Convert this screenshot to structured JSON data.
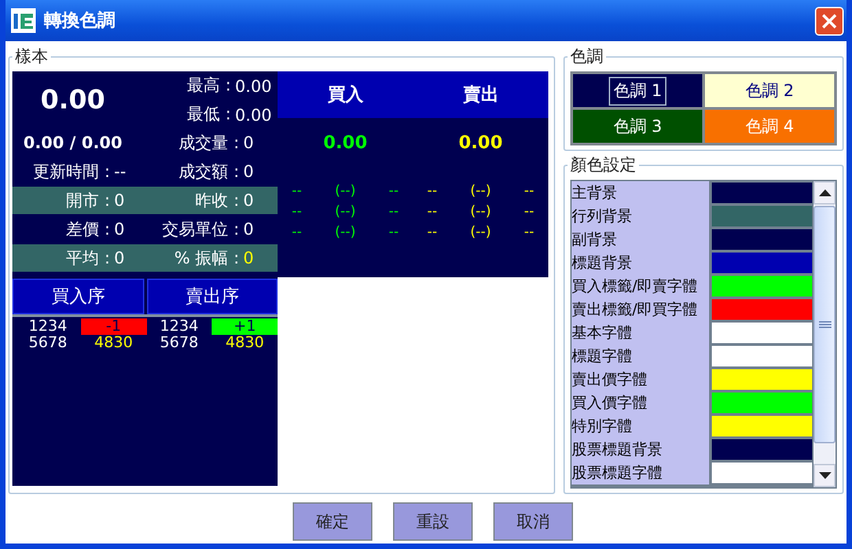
{
  "window": {
    "title": "轉換色調"
  },
  "sample": {
    "legend": "樣本",
    "price": "0.00",
    "top_stats": [
      {
        "label": "最高 :",
        "value": "0.00"
      },
      {
        "label": "最低 :",
        "value": "0.00"
      }
    ],
    "rows": [
      {
        "shaded": false,
        "cells": [
          {
            "kind": "plain",
            "value": "0.00 / 0.00"
          },
          {
            "kind": "pair",
            "label": "成交量 :",
            "value": "0",
            "highlight": false
          }
        ]
      },
      {
        "shaded": false,
        "cells": [
          {
            "kind": "pair",
            "label": "更新時間 :",
            "value": "--",
            "highlight": false
          },
          {
            "kind": "pair",
            "label": "成交額 :",
            "value": "0",
            "highlight": false
          }
        ]
      },
      {
        "shaded": true,
        "cells": [
          {
            "kind": "pair",
            "label": "開市 :",
            "value": "0",
            "highlight": false
          },
          {
            "kind": "pair",
            "label": "昨收 :",
            "value": "0",
            "highlight": false
          }
        ]
      },
      {
        "shaded": false,
        "cells": [
          {
            "kind": "pair",
            "label": "差價 :",
            "value": "0",
            "highlight": false
          },
          {
            "kind": "pair",
            "label": "交易單位 :",
            "value": "0",
            "highlight": false
          }
        ]
      },
      {
        "shaded": true,
        "cells": [
          {
            "kind": "pair",
            "label": "平均 :",
            "value": "0",
            "highlight": false
          },
          {
            "kind": "pair",
            "label": "% 振幅 :",
            "value": "0",
            "highlight": true
          }
        ]
      }
    ],
    "sides": [
      {
        "label": "買入",
        "price": "0.00",
        "kind": "buy",
        "depth": [
          [
            "--",
            "(--)",
            "--"
          ],
          [
            "--",
            "(--)",
            "--"
          ],
          [
            "--",
            "(--)",
            "--"
          ]
        ]
      },
      {
        "label": "賣出",
        "price": "0.00",
        "kind": "sell",
        "depth": [
          [
            "--",
            "(--)",
            "--"
          ],
          [
            "--",
            "(--)",
            "--"
          ],
          [
            "--",
            "(--)",
            "--"
          ]
        ]
      }
    ],
    "order_tables": [
      {
        "title": "買入序",
        "rows": [
          {
            "qty": "1234",
            "value": "-1",
            "color": "#ff0000"
          },
          {
            "qty": "5678",
            "value": "4830"
          }
        ]
      },
      {
        "title": "賣出序",
        "rows": [
          {
            "qty": "1234",
            "value": "+1",
            "color": "#00ff00"
          },
          {
            "qty": "5678",
            "value": "4830"
          }
        ]
      }
    ]
  },
  "themes": {
    "legend": "色調",
    "items": [
      {
        "label": "色調 1",
        "selected": true,
        "color": "#000050"
      },
      {
        "label": "色調 2",
        "selected": false,
        "color": "#ffffd0"
      },
      {
        "label": "色調 3",
        "selected": false,
        "color": "#005000"
      },
      {
        "label": "色調 4",
        "selected": false,
        "color": "#f87000"
      }
    ]
  },
  "color_settings": {
    "legend": "顏色設定",
    "items": [
      {
        "label": "主背景",
        "color": "#000050"
      },
      {
        "label": "行列背景",
        "color": "#336666"
      },
      {
        "label": "副背景",
        "color": "#000050"
      },
      {
        "label": "標題背景",
        "color": "#0000b0"
      },
      {
        "label": "買入標籤/即賣字體",
        "color": "#00ff00"
      },
      {
        "label": "賣出標籤/即買字體",
        "color": "#ff0000"
      },
      {
        "label": "基本字體",
        "color": "#ffffff"
      },
      {
        "label": "標題字體",
        "color": "#ffffff"
      },
      {
        "label": "賣出價字體",
        "color": "#ffff00"
      },
      {
        "label": "買入價字體",
        "color": "#00ff00"
      },
      {
        "label": "特別字體",
        "color": "#ffff00"
      },
      {
        "label": "股票標題背景",
        "color": "#000050"
      },
      {
        "label": "股票標題字體",
        "color": "#ffffff"
      }
    ]
  },
  "buttons": [
    "確定",
    "重設",
    "取消"
  ]
}
